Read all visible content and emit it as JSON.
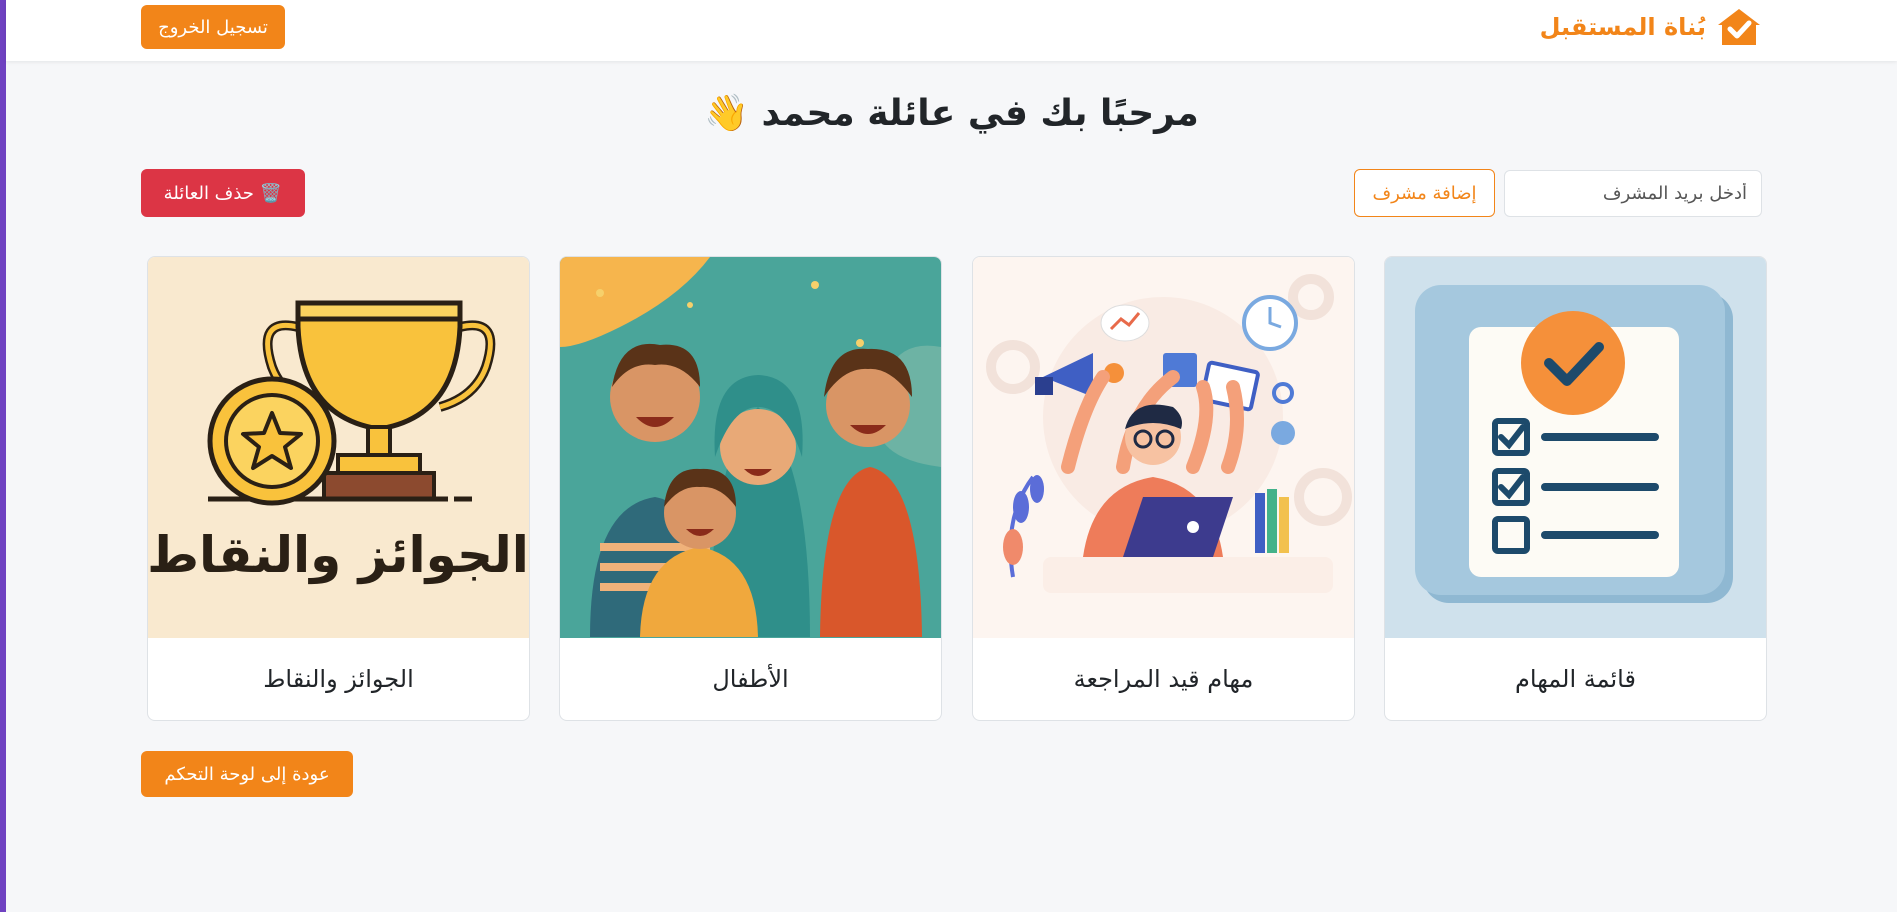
{
  "navbar": {
    "brand_name": "بُناة المستقبل",
    "logout_label": "تسجيل الخروج"
  },
  "welcome": {
    "title": "مرحبًا بك في عائلة محمد",
    "emoji": "👋"
  },
  "admin": {
    "email_placeholder": "أدخل بريد المشرف",
    "add_label": "إضافة مشرف"
  },
  "delete_family": {
    "icon": "🗑️",
    "label": "حذف العائلة"
  },
  "cards": [
    {
      "title": "قائمة المهام",
      "icon": "checklist-illustration"
    },
    {
      "title": "مهام قيد المراجعة",
      "icon": "multitasking-illustration"
    },
    {
      "title": "الأطفال",
      "icon": "family-illustration"
    },
    {
      "title": "الجوائز والنقاط",
      "icon": "trophy-illustration",
      "image_text": "الجوائز والنقاط"
    }
  ],
  "back_label": "عودة إلى لوحة التحكم",
  "colors": {
    "primary": "#f28519",
    "danger": "#dc3545",
    "sidebar_accent": "#6f42c1"
  }
}
